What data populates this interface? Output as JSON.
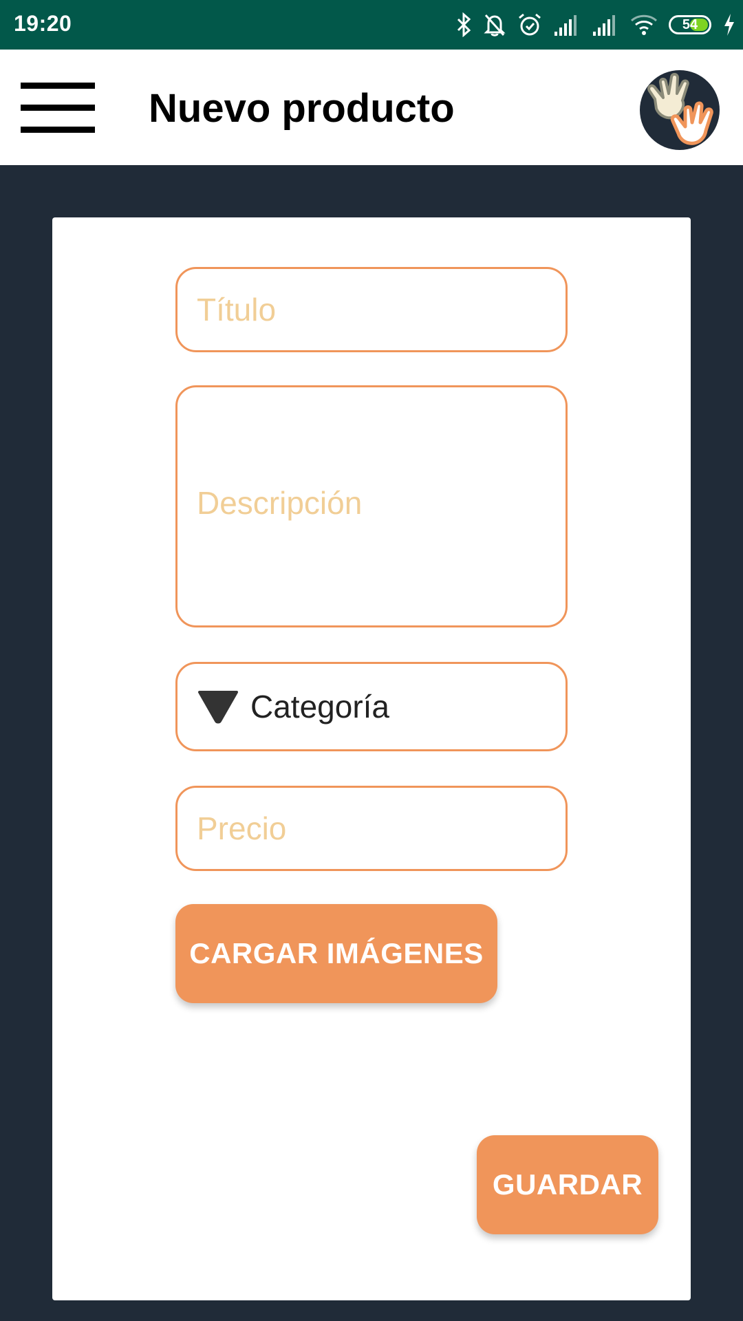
{
  "status_bar": {
    "time": "19:20",
    "battery_level": "54",
    "icons": [
      "bluetooth-icon",
      "notifications-off-icon",
      "alarm-icon",
      "signal-icon",
      "signal-icon",
      "wifi-icon",
      "battery-icon",
      "charging-icon"
    ]
  },
  "app_bar": {
    "title": "Nuevo producto",
    "menu_icon": "hamburger-menu-icon",
    "logo_icon": "hands-logo-icon"
  },
  "form": {
    "title_placeholder": "Título",
    "description_placeholder": "Descripción",
    "category_label": "Categoría",
    "price_placeholder": "Precio",
    "upload_button": "CARGAR IMÁGENES",
    "save_button": "GUARDAR"
  },
  "colors": {
    "status_bar": "#02584a",
    "background": "#202b38",
    "accent": "#f0955a",
    "placeholder": "#f1ce96"
  }
}
